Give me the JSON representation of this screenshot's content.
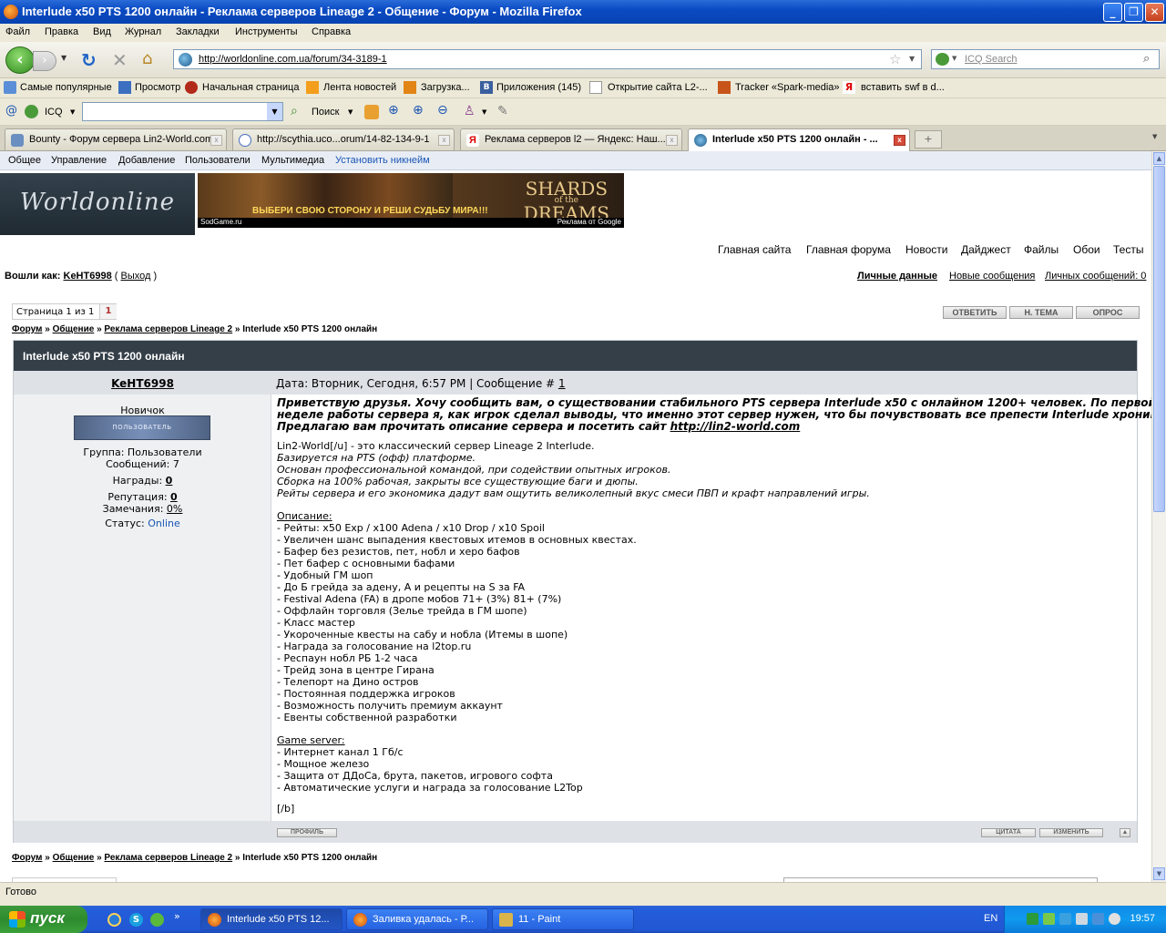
{
  "window": {
    "title": "Interlude x50 PTS 1200 онлайн - Реклама серверов Lineage 2 - Общение - Форум - Mozilla Firefox",
    "min": "_",
    "max": "❐",
    "close": "✕"
  },
  "menu": [
    "Файл",
    "Правка",
    "Вид",
    "Журнал",
    "Закладки",
    "Инструменты",
    "Справка"
  ],
  "address": {
    "url": "http://worldonline.com.ua/forum/34-3189-1",
    "search_placeholder": "ICQ Search"
  },
  "bookmarks": [
    "Самые популярные",
    "Просмотр",
    "Начальная страница",
    "Лента новостей",
    "Загрузка...",
    "Приложения (145)",
    "Открытие сайта L2-...",
    "Tracker «Spark-media»",
    "вставить swf в d..."
  ],
  "icq": {
    "label": "ICQ",
    "search_label": "Поиск"
  },
  "tabs": [
    {
      "label": "Bounty - Форум сервера Lin2-World.com"
    },
    {
      "label": "http://scythia.uco...orum/14-82-134-9-1"
    },
    {
      "label": "Реклама серверов l2 — Яндекс: Наш..."
    },
    {
      "label": "Interlude x50 PTS 1200 онлайн - ..."
    }
  ],
  "site": {
    "topnav": [
      "Общее",
      "Управление",
      "Добавление",
      "Пользователи",
      "Мультимедиа",
      "Установить никнейм"
    ],
    "logo": "Worldonline",
    "banner": {
      "slogan": "ВЫБЕРИ СВОЮ СТОРОНУ И РЕШИ СУДЬБУ МИРА!!!",
      "game_title_1": "SHARDS",
      "game_title_2": "of the",
      "game_title_3": "DREAMS",
      "caption_left": "SodGame.ru",
      "caption_right": "Реклама от Google"
    },
    "mainnav": [
      "Главная сайта",
      "Главная форума",
      "Новости",
      "Дайджест",
      "Файлы",
      "Обои",
      "Тесты"
    ],
    "logged_in_label": "Вошли как:",
    "logged_in_user": "KeHT6998",
    "logout": "Выход",
    "usernav": [
      "Личные данные",
      "Новые сообщения",
      "Личных сообщений: 0"
    ],
    "pager": {
      "label": "Страница 1 из 1",
      "current": "1"
    },
    "buttons": [
      "ОТВЕТИТЬ",
      "Н. ТЕМА",
      "ОПРОС"
    ],
    "breadcrumbs": [
      "Форум",
      "Общение",
      "Реклама серверов Lineage 2",
      "Interlude x50 PTS 1200 онлайн"
    ],
    "sep": "»"
  },
  "post": {
    "title": "Interlude x50 PTS 1200 онлайн",
    "author": "KeHT6998",
    "date_line": "Дата: Вторник, Сегодня, 6:57 PM | Сообщение #",
    "msg_no": "1",
    "rank": "Новичок",
    "rank_badge": "ПОЛЬЗОВАТЕЛЬ",
    "group": "Группа: Пользователи",
    "messages": "Сообщений: 7",
    "awards_label": "Награды:",
    "awards": "0",
    "rep_label": "Репутация:",
    "rep": "0",
    "warn_label": "Замечания:",
    "warn": "0%",
    "status_label": "Статус:",
    "status": "Online",
    "intro": [
      "Приветствую друзья. Хочу сообщить вам, о существовании стабильного PTS сервера Interlude x50 с онлайном 1200+ человек. По первой",
      "неделе работы сервера я, как игрок сделал выводы, что именно этот сервер нужен, что бы почувствовать все препести Interlude хроник.",
      "Предлагаю вам прочитать описание сервера и посетить сайт "
    ],
    "site_link": "http://lin2-world.com",
    "about": [
      "Lin2-World[/u] - это классический сервер Lineage 2 Interlude.",
      "Базируется на PTS (офф) платформе.",
      "Основан профессиональной командой, при содействии опытных игроков.",
      "Сборка на 100% рабочая, закрыты все существующие баги и дюпы.",
      "Рейты сервера и его экономика дадут вам ощутить великолепный вкус смеси ПВП и крафт направлений игры."
    ],
    "desc_heading": "Описание:",
    "desc": [
      "- Рейты: x50 Exp / x100 Adena / x10 Drop / x10 Spoil",
      "- Увеличен шанс выпадения квестовых итемов в основных квестах.",
      "- Бафер без резистов, пет, нобл и херо бафов",
      "- Пет бафер с основными бафами",
      "- Удобный ГМ шоп",
      "- До Б грейда за адену, А и рецепты на S за FA",
      "- Festival Adena (FA) в дропе мобов 71+ (3%) 81+ (7%)",
      "- Оффлайн торговля (Зелье трейда в ГМ шопе)",
      "- Класс мастер",
      "- Укороченные квесты на сабу и нобла (Итемы в шопе)",
      "- Награда за голосование на l2top.ru",
      "- Респаун нобл РБ 1-2 часа",
      "- Трейд зона в центре Гирана",
      "- Телепорт на Дино остров",
      "- Постоянная поддержка игроков",
      "- Возможность получить премиум аккаунт",
      "- Евенты собственной разработки"
    ],
    "gs_heading": "Game server:",
    "gs": [
      "- Интернет канал 1 Гб/с",
      "- Мощное железо",
      "- Защита от ДДоСа, брута, пакетов, игрового софта",
      "- Автоматические услуги и награда за голосование L2Top"
    ],
    "tail": "[/b]",
    "footer_buttons": {
      "profile": "ПРОФИЛЬ",
      "quote": "ЦИТАТА",
      "edit": "ИЗМЕНИТЬ"
    }
  },
  "statusbar": "Готово",
  "taskbar": {
    "start": "пуск",
    "tasks": [
      "Interlude x50 PTS 12...",
      "Заливка удалась - Р...",
      "11 - Paint"
    ],
    "lang": "EN",
    "clock": "19:57"
  }
}
